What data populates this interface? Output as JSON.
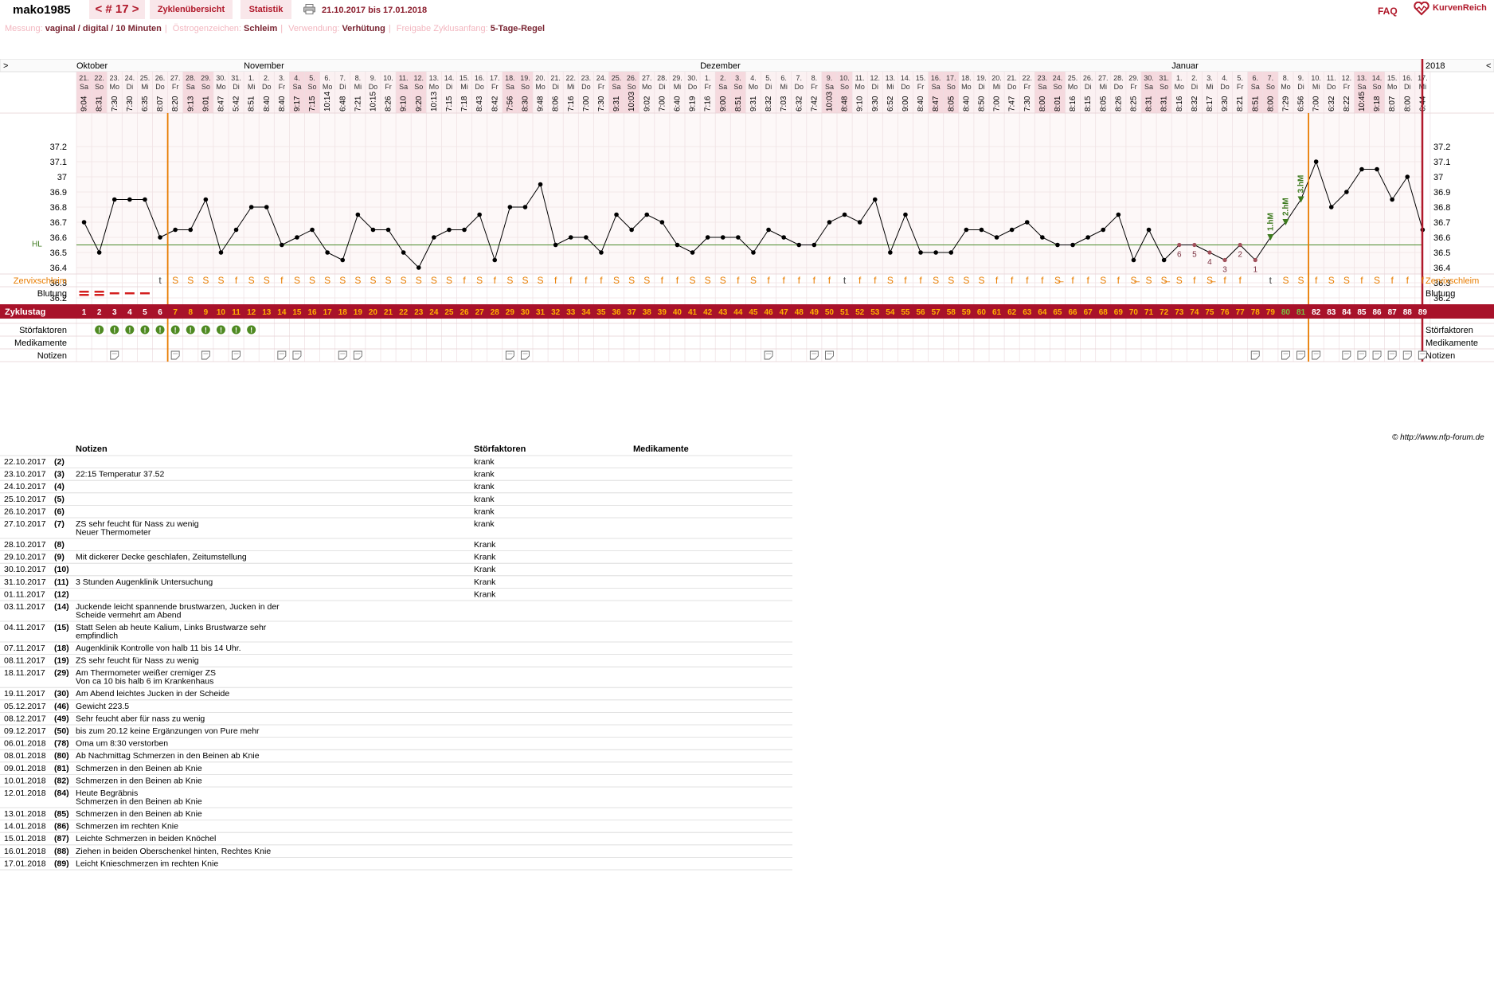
{
  "header": {
    "username": "mako1985",
    "cycle_nav": "< # 17 >",
    "tab_overview": "Zyklenübersicht",
    "tab_statistics": "Statistik",
    "date_range": "21.10.2017 bis 17.01.2018",
    "faq": "FAQ",
    "logo": "KurvenReich"
  },
  "info": {
    "messung_label": "Messung:",
    "messung_value": "vaginal / digital / 10 Minuten",
    "oestrogen_label": "Östrogenzeichen:",
    "oestrogen_value": "Schleim",
    "verwendung_label": "Verwendung:",
    "verwendung_value": "Verhütung",
    "freigabe_label": "Freigabe Zyklusanfang:",
    "freigabe_value": "5-Tage-Regel"
  },
  "colors": {
    "accent": "#b0182a",
    "temp_line": "#000000",
    "orange": "#e87c00",
    "green": "#3d7a1e",
    "pink_bg": "#f9e7ea"
  },
  "chart_data": {
    "type": "line",
    "title": "",
    "xlabel": "",
    "ylabel": "",
    "ylim": [
      36.1,
      37.3
    ],
    "y_ticks": [
      "37.2",
      "37.1",
      "37",
      "36.9",
      "36.8",
      "36.7",
      "36.6",
      "36.5",
      "36.4",
      "36.3",
      "36.2"
    ],
    "hl_label": "HL",
    "hl_value": 36.55,
    "month_labels": [
      "Oktober",
      "November",
      "Dezember",
      "Januar"
    ],
    "month_start_days": [
      1,
      12,
      42,
      73
    ],
    "year_label": "2018",
    "nav_left": ">",
    "nav_right": "<",
    "day_of_month": [
      "21.",
      "22.",
      "23.",
      "24.",
      "25.",
      "26.",
      "27.",
      "28.",
      "29.",
      "30.",
      "31.",
      "1.",
      "2.",
      "3.",
      "4.",
      "5.",
      "6.",
      "7.",
      "8.",
      "9.",
      "10.",
      "11.",
      "12.",
      "13.",
      "14.",
      "15.",
      "16.",
      "17.",
      "18.",
      "19.",
      "20.",
      "21.",
      "22.",
      "23.",
      "24.",
      "25.",
      "26.",
      "27.",
      "28.",
      "29.",
      "30.",
      "1.",
      "2.",
      "3.",
      "4.",
      "5.",
      "6.",
      "7.",
      "8.",
      "9.",
      "10.",
      "11.",
      "12.",
      "13.",
      "14.",
      "15.",
      "16.",
      "17.",
      "18.",
      "19.",
      "20.",
      "21.",
      "22.",
      "23.",
      "24.",
      "25.",
      "26.",
      "27.",
      "28.",
      "29.",
      "30.",
      "31.",
      "1.",
      "2.",
      "3.",
      "4.",
      "5.",
      "6.",
      "7.",
      "8.",
      "9.",
      "10.",
      "11.",
      "12.",
      "13.",
      "14.",
      "15.",
      "16.",
      "17."
    ],
    "weekdays": [
      "Sa",
      "So",
      "Mo",
      "Di",
      "Mi",
      "Do",
      "Fr",
      "Sa",
      "So",
      "Mo",
      "Di",
      "Mi",
      "Do",
      "Fr",
      "Sa",
      "So",
      "Mo",
      "Di",
      "Mi",
      "Do",
      "Fr",
      "Sa",
      "So",
      "Mo",
      "Di",
      "Mi",
      "Do",
      "Fr",
      "Sa",
      "So",
      "Mo",
      "Di",
      "Mi",
      "Do",
      "Fr",
      "Sa",
      "So",
      "Mo",
      "Di",
      "Mi",
      "Do",
      "Fr",
      "Sa",
      "So",
      "Mo",
      "Di",
      "Mi",
      "Do",
      "Fr",
      "Sa",
      "So",
      "Mo",
      "Di",
      "Mi",
      "Do",
      "Fr",
      "Sa",
      "So",
      "Mo",
      "Di",
      "Mi",
      "Do",
      "Fr",
      "Sa",
      "So",
      "Mo",
      "Di",
      "Mi",
      "Do",
      "Fr",
      "Sa",
      "So",
      "Mo",
      "Di",
      "Mi",
      "Do",
      "Fr",
      "Sa",
      "So",
      "Mo",
      "Di",
      "Mi",
      "Do",
      "Fr",
      "Sa",
      "So",
      "Mo",
      "Di",
      "Mi"
    ],
    "times": [
      "9:04",
      "8:31",
      "7:30",
      "7:30",
      "6:35",
      "8:07",
      "8:20",
      "9:13",
      "9:01",
      "8:47",
      "5:42",
      "8:51",
      "8:40",
      "8:40",
      "9:17",
      "7:15",
      "10:14",
      "6:48",
      "7:21",
      "10:15",
      "8:26",
      "9:10",
      "9:20",
      "10:13",
      "7:15",
      "7:18",
      "8:43",
      "8:42",
      "7:56",
      "8:30",
      "9:48",
      "8:06",
      "7:16",
      "7:00",
      "7:30",
      "9:31",
      "10:03",
      "9:02",
      "7:00",
      "6:40",
      "9:19",
      "7:16",
      "9:00",
      "8:51",
      "9:31",
      "8:32",
      "7:03",
      "6:32",
      "7:42",
      "10:03",
      "8:48",
      "9:10",
      "9:30",
      "6:52",
      "9:00",
      "8:40",
      "8:47",
      "8:05",
      "8:40",
      "8:50",
      "7:00",
      "7:47",
      "7:30",
      "8:00",
      "8:01",
      "8:16",
      "8:15",
      "8:05",
      "8:26",
      "8:25",
      "8:31",
      "8:31",
      "8:16",
      "8:32",
      "8:17",
      "9:30",
      "8:21",
      "8:51",
      "8:00",
      "7:29",
      "6:56",
      "7:00",
      "6:32",
      "8:22",
      "10:45",
      "9:18",
      "8:07",
      "8:00",
      "6:44"
    ],
    "temps": [
      36.7,
      36.5,
      36.85,
      36.85,
      36.85,
      36.6,
      36.65,
      36.65,
      36.85,
      36.5,
      36.65,
      36.8,
      36.8,
      36.55,
      36.6,
      36.65,
      36.5,
      36.45,
      36.75,
      36.65,
      36.65,
      36.5,
      36.4,
      36.6,
      36.65,
      36.65,
      36.75,
      36.45,
      36.8,
      36.8,
      36.95,
      36.55,
      36.6,
      36.6,
      36.5,
      36.75,
      36.65,
      36.75,
      36.7,
      36.55,
      36.5,
      36.6,
      36.6,
      36.6,
      36.5,
      36.65,
      36.6,
      36.55,
      36.55,
      36.7,
      36.75,
      36.7,
      36.85,
      36.5,
      36.75,
      36.5,
      36.5,
      36.5,
      36.65,
      36.65,
      36.6,
      36.65,
      36.7,
      36.6,
      36.55,
      36.55,
      36.6,
      36.65,
      36.75,
      36.45,
      36.65,
      36.45,
      36.55,
      36.55,
      36.5,
      36.45,
      36.55,
      36.45,
      36.6,
      36.7,
      36.85,
      37.1,
      36.8,
      36.9,
      37.05,
      37.05,
      36.85,
      37.0,
      36.65
    ],
    "lower_count_labels": [
      {
        "day": 73,
        "label": "6"
      },
      {
        "day": 74,
        "label": "5"
      },
      {
        "day": 75,
        "label": "4"
      },
      {
        "day": 76,
        "label": "3"
      },
      {
        "day": 77,
        "label": "2"
      },
      {
        "day": 78,
        "label": "1"
      }
    ],
    "higher_measurements": [
      {
        "day": 79,
        "label": "1.hM"
      },
      {
        "day": 80,
        "label": "2.hM"
      },
      {
        "day": 81,
        "label": "3.hM"
      }
    ],
    "ovulation_lines_after_days": [
      6,
      81
    ],
    "cervix_label": "Zervixschleim",
    "cervix": [
      "",
      "",
      "",
      "",
      "",
      "t",
      "S",
      "S",
      "S",
      "S",
      "f",
      "S",
      "S",
      "f",
      "S",
      "S",
      "S",
      "S",
      "S",
      "S",
      "S",
      "S",
      "S",
      "S",
      "S",
      "f",
      "S",
      "f",
      "S",
      "S",
      "S",
      "f",
      "f",
      "f",
      "f",
      "S",
      "S",
      "S",
      "f",
      "f",
      "S",
      "S",
      "S",
      "f",
      "S",
      "f",
      "f",
      "f",
      "f",
      "f",
      "t",
      "f",
      "f",
      "S",
      "f",
      "f",
      "S",
      "S",
      "S",
      "S",
      "f",
      "f",
      "f",
      "f",
      "S̶",
      "f",
      "f",
      "S",
      "f",
      "S̶",
      "S",
      "S̶",
      "S",
      "f",
      "S̶",
      "f",
      "f",
      "",
      "t",
      "S",
      "S",
      "f",
      "S",
      "S",
      "f",
      "S",
      "f",
      "f",
      "f",
      "S"
    ],
    "bleeding_label": "Blutung",
    "bleeding": [
      "heavy",
      "heavy",
      "light",
      "light",
      "light",
      "",
      "",
      "",
      "",
      "",
      "",
      "",
      "",
      "",
      "",
      "",
      "",
      "",
      "",
      "",
      "",
      "",
      "",
      "",
      "",
      "",
      "",
      "",
      "",
      "",
      "",
      "",
      "",
      "",
      "",
      "",
      "",
      "",
      "",
      "",
      "",
      "",
      "",
      "",
      "",
      "",
      "",
      "",
      "",
      "",
      "",
      "",
      "",
      "",
      "",
      "",
      "",
      "",
      "",
      "",
      "",
      "",
      "",
      "",
      "",
      "",
      "",
      "",
      "",
      "",
      "",
      "",
      "",
      "",
      "",
      "",
      "",
      "",
      "",
      "",
      "",
      "",
      "",
      "",
      "",
      "",
      "",
      "",
      "",
      ""
    ],
    "cycle_day_label": "Zyklustag",
    "cycle_days": [
      "1",
      "2",
      "3",
      "4",
      "5",
      "6",
      "7",
      "8",
      "9",
      "10",
      "11",
      "12",
      "13",
      "14",
      "15",
      "16",
      "17",
      "18",
      "19",
      "20",
      "21",
      "22",
      "23",
      "24",
      "25",
      "26",
      "27",
      "28",
      "29",
      "30",
      "31",
      "32",
      "33",
      "34",
      "35",
      "36",
      "37",
      "38",
      "39",
      "40",
      "41",
      "42",
      "43",
      "44",
      "45",
      "46",
      "47",
      "48",
      "49",
      "50",
      "51",
      "52",
      "53",
      "54",
      "55",
      "56",
      "57",
      "58",
      "59",
      "60",
      "61",
      "62",
      "63",
      "64",
      "65",
      "66",
      "67",
      "68",
      "69",
      "70",
      "71",
      "72",
      "73",
      "74",
      "75",
      "76",
      "77",
      "78",
      "79",
      "80",
      "81",
      "82",
      "83",
      "84",
      "85",
      "86",
      "87",
      "88",
      "89"
    ],
    "disturbance_label": "Störfaktoren",
    "disturbance_days": [
      2,
      3,
      4,
      5,
      6,
      7,
      8,
      9,
      10,
      11,
      12
    ],
    "medication_label": "Medikamente",
    "notes_label": "Notizen",
    "note_days": [
      3,
      7,
      9,
      11,
      14,
      15,
      18,
      19,
      29,
      30,
      46,
      49,
      50,
      78,
      80,
      81,
      82,
      84,
      85,
      86,
      87,
      88,
      89
    ]
  },
  "notes_table": {
    "headers": {
      "notes": "Notizen",
      "disturbances": "Störfaktoren",
      "medications": "Medikamente"
    },
    "rows": [
      {
        "date": "22.10.2017",
        "day": "(2)",
        "note": "",
        "dist": "krank"
      },
      {
        "date": "23.10.2017",
        "day": "(3)",
        "note": "22:15 Temperatur 37.52",
        "dist": "krank"
      },
      {
        "date": "24.10.2017",
        "day": "(4)",
        "note": "",
        "dist": "krank"
      },
      {
        "date": "25.10.2017",
        "day": "(5)",
        "note": "",
        "dist": "krank"
      },
      {
        "date": "26.10.2017",
        "day": "(6)",
        "note": "",
        "dist": "krank"
      },
      {
        "date": "27.10.2017",
        "day": "(7)",
        "note": "ZS sehr feucht für Nass zu wenig",
        "note2": "Neuer Thermometer",
        "dist": "krank"
      },
      {
        "date": "28.10.2017",
        "day": "(8)",
        "note": "",
        "dist": "Krank"
      },
      {
        "date": "29.10.2017",
        "day": "(9)",
        "note": "Mit dickerer Decke geschlafen, Zeitumstellung",
        "dist": "Krank"
      },
      {
        "date": "30.10.2017",
        "day": "(10)",
        "note": "",
        "dist": "Krank"
      },
      {
        "date": "31.10.2017",
        "day": "(11)",
        "note": "3 Stunden Augenklinik Untersuchung",
        "dist": "Krank"
      },
      {
        "date": "01.11.2017",
        "day": "(12)",
        "note": "",
        "dist": "Krank"
      },
      {
        "date": "03.11.2017",
        "day": "(14)",
        "note": "Juckende leicht spannende brustwarzen, Jucken in der",
        "note2": "Scheide vermehrt am Abend",
        "dist": ""
      },
      {
        "date": "04.11.2017",
        "day": "(15)",
        "note": "Statt Selen ab heute Kalium, Links Brustwarze sehr",
        "note2": "empfindlich",
        "dist": ""
      },
      {
        "date": "07.11.2017",
        "day": "(18)",
        "note": "Augenklinik Kontrolle von halb 11 bis 14 Uhr.",
        "dist": ""
      },
      {
        "date": "08.11.2017",
        "day": "(19)",
        "note": "ZS sehr feucht für Nass zu wenig",
        "dist": ""
      },
      {
        "date": "18.11.2017",
        "day": "(29)",
        "note": "Am Thermometer weißer cremiger ZS",
        "note2": "Von ca 10 bis halb 6 im Krankenhaus",
        "dist": ""
      },
      {
        "date": "19.11.2017",
        "day": "(30)",
        "note": "Am Abend leichtes Jucken in der Scheide",
        "dist": ""
      },
      {
        "date": "05.12.2017",
        "day": "(46)",
        "note": "Gewicht 223.5",
        "dist": ""
      },
      {
        "date": "08.12.2017",
        "day": "(49)",
        "note": "Sehr feucht aber für nass zu wenig",
        "dist": ""
      },
      {
        "date": "09.12.2017",
        "day": "(50)",
        "note": "bis zum 20.12 keine Ergänzungen von Pure mehr",
        "dist": ""
      },
      {
        "date": "06.01.2018",
        "day": "(78)",
        "note": "Oma um 8:30 verstorben",
        "dist": ""
      },
      {
        "date": "08.01.2018",
        "day": "(80)",
        "note": "Ab Nachmittag Schmerzen in den Beinen ab Knie",
        "dist": ""
      },
      {
        "date": "09.01.2018",
        "day": "(81)",
        "note": "Schmerzen in den Beinen ab Knie",
        "dist": ""
      },
      {
        "date": "10.01.2018",
        "day": "(82)",
        "note": "Schmerzen in den Beinen ab Knie",
        "dist": ""
      },
      {
        "date": "12.01.2018",
        "day": "(84)",
        "note": "Heute Begräbnis",
        "note2": "Schmerzen in den Beinen ab Knie",
        "dist": ""
      },
      {
        "date": "13.01.2018",
        "day": "(85)",
        "note": "Schmerzen in den Beinen ab Knie",
        "dist": ""
      },
      {
        "date": "14.01.2018",
        "day": "(86)",
        "note": "Schmerzen im rechten Knie",
        "dist": ""
      },
      {
        "date": "15.01.2018",
        "day": "(87)",
        "note": "Leichte Schmerzen in beiden Knöchel",
        "dist": ""
      },
      {
        "date": "16.01.2018",
        "day": "(88)",
        "note": "Ziehen in beiden Oberschenkel hinten, Rechtes Knie",
        "dist": ""
      },
      {
        "date": "17.01.2018",
        "day": "(89)",
        "note": "Leicht Knieschmerzen im rechten Knie",
        "dist": ""
      }
    ]
  },
  "footer": {
    "copyright": "© http://www.nfp-forum.de"
  }
}
